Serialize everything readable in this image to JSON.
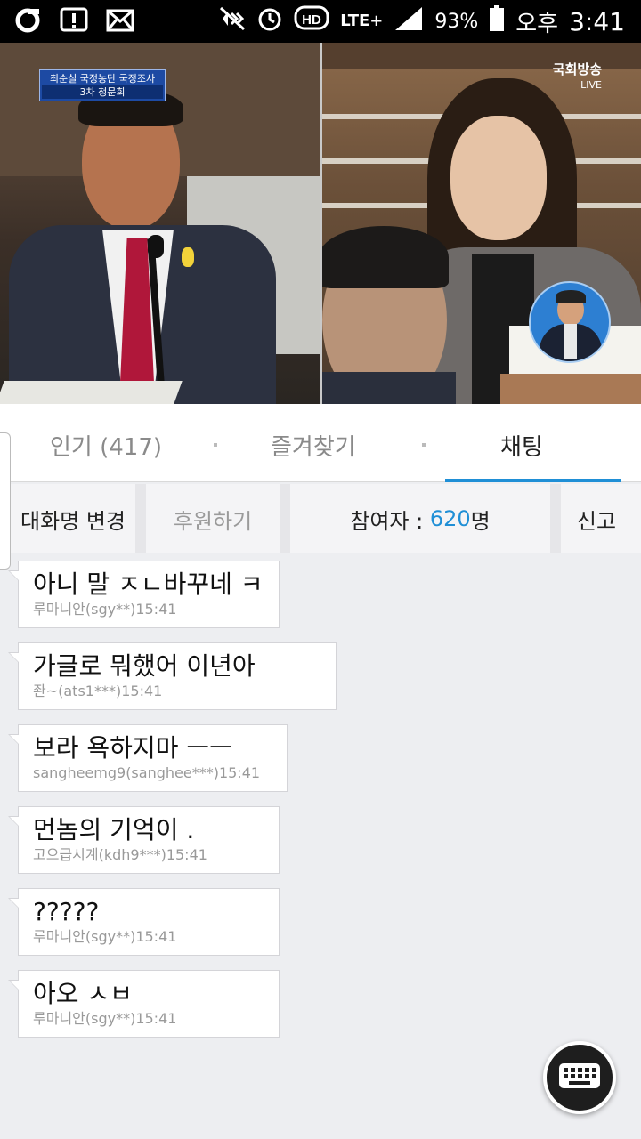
{
  "status_bar": {
    "battery_percent": "93%",
    "ampm": "오후",
    "time": "3:41",
    "network": "LTE+",
    "hd_label": "HD"
  },
  "video": {
    "caption_title": "최순실 국정농단 국정조사",
    "caption_sub": "3차 청문회",
    "broadcaster": "국회방송",
    "live_label": "LIVE"
  },
  "tabs": [
    {
      "label": "인기 (417)",
      "active": false
    },
    {
      "label": "즐겨찾기",
      "active": false
    },
    {
      "label": "채팅",
      "active": true
    }
  ],
  "toolbar": {
    "rename_label": "대화명 변경",
    "donate_label": "후원하기",
    "participants_prefix": "참여자 : ",
    "participants_count": "620",
    "participants_suffix": "명",
    "report_label": "신고"
  },
  "messages": [
    {
      "text": "아니 말 ㅈㄴ바꾸네 ㅋ",
      "meta": "루마니안(sgy**)15:41"
    },
    {
      "text": "가글로 뭐했어 이년아",
      "meta": "좐~(ats1***)15:41"
    },
    {
      "text": "보라 욕하지마 ㅡㅡ",
      "meta": "sangheemg9(sanghee***)15:41"
    },
    {
      "text": "먼놈의 기억이 .",
      "meta": "고으급시계(kdh9***)15:41"
    },
    {
      "text": "?????",
      "meta": "루마니안(sgy**)15:41"
    },
    {
      "text": "아오 ㅅㅂ",
      "meta": "루마니안(sgy**)15:41"
    }
  ],
  "colors": {
    "accent": "#1f8fd6",
    "status_bar_bg": "#000000",
    "chat_bg": "#edeef1"
  },
  "icons": [
    "notification-o-icon",
    "alert-icon",
    "mail-icon",
    "mute-icon",
    "alarm-icon",
    "hd-icon",
    "lte-icon",
    "signal-icon",
    "battery-icon",
    "keyboard-icon"
  ]
}
